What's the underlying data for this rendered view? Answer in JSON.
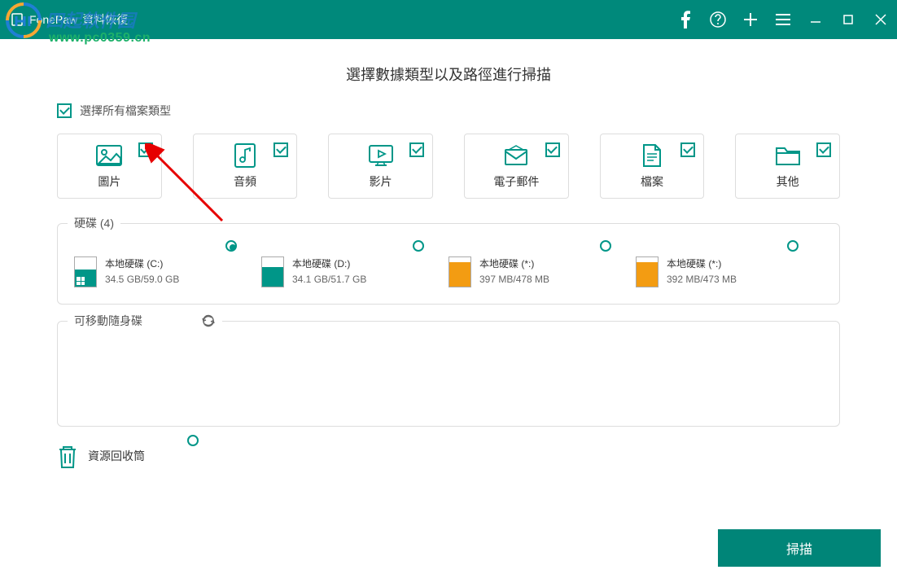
{
  "titlebar": {
    "appName": "FonePaw",
    "appSubtitle": "資料恢復"
  },
  "watermark": {
    "text": "四起软件园",
    "url": "www.pc0359.cn"
  },
  "headline": "選擇數據類型以及路徑進行掃描",
  "selectAll": {
    "label": "選擇所有檔案類型",
    "checked": true
  },
  "types": [
    {
      "label": "圖片",
      "checked": true
    },
    {
      "label": "音頻",
      "checked": true
    },
    {
      "label": "影片",
      "checked": true
    },
    {
      "label": "電子郵件",
      "checked": true
    },
    {
      "label": "檔案",
      "checked": true
    },
    {
      "label": "其他",
      "checked": true
    }
  ],
  "disks": {
    "legend": "硬碟 (4)",
    "items": [
      {
        "name": "本地硬碟 (C:)",
        "size": "34.5 GB/59.0 GB",
        "selected": true,
        "fillColor": "#009688",
        "fillPercent": 58,
        "isSystem": true
      },
      {
        "name": "本地硬碟 (D:)",
        "size": "34.1 GB/51.7 GB",
        "selected": false,
        "fillColor": "#009688",
        "fillPercent": 66
      },
      {
        "name": "本地硬碟 (*:)",
        "size": "397 MB/478 MB",
        "selected": false,
        "fillColor": "#f39c12",
        "fillPercent": 83
      },
      {
        "name": "本地硬碟 (*:)",
        "size": "392 MB/473 MB",
        "selected": false,
        "fillColor": "#f39c12",
        "fillPercent": 83
      }
    ]
  },
  "removable": {
    "legend": "可移動隨身碟"
  },
  "recycle": {
    "label": "資源回收筒",
    "selected": false
  },
  "scanButton": "掃描"
}
